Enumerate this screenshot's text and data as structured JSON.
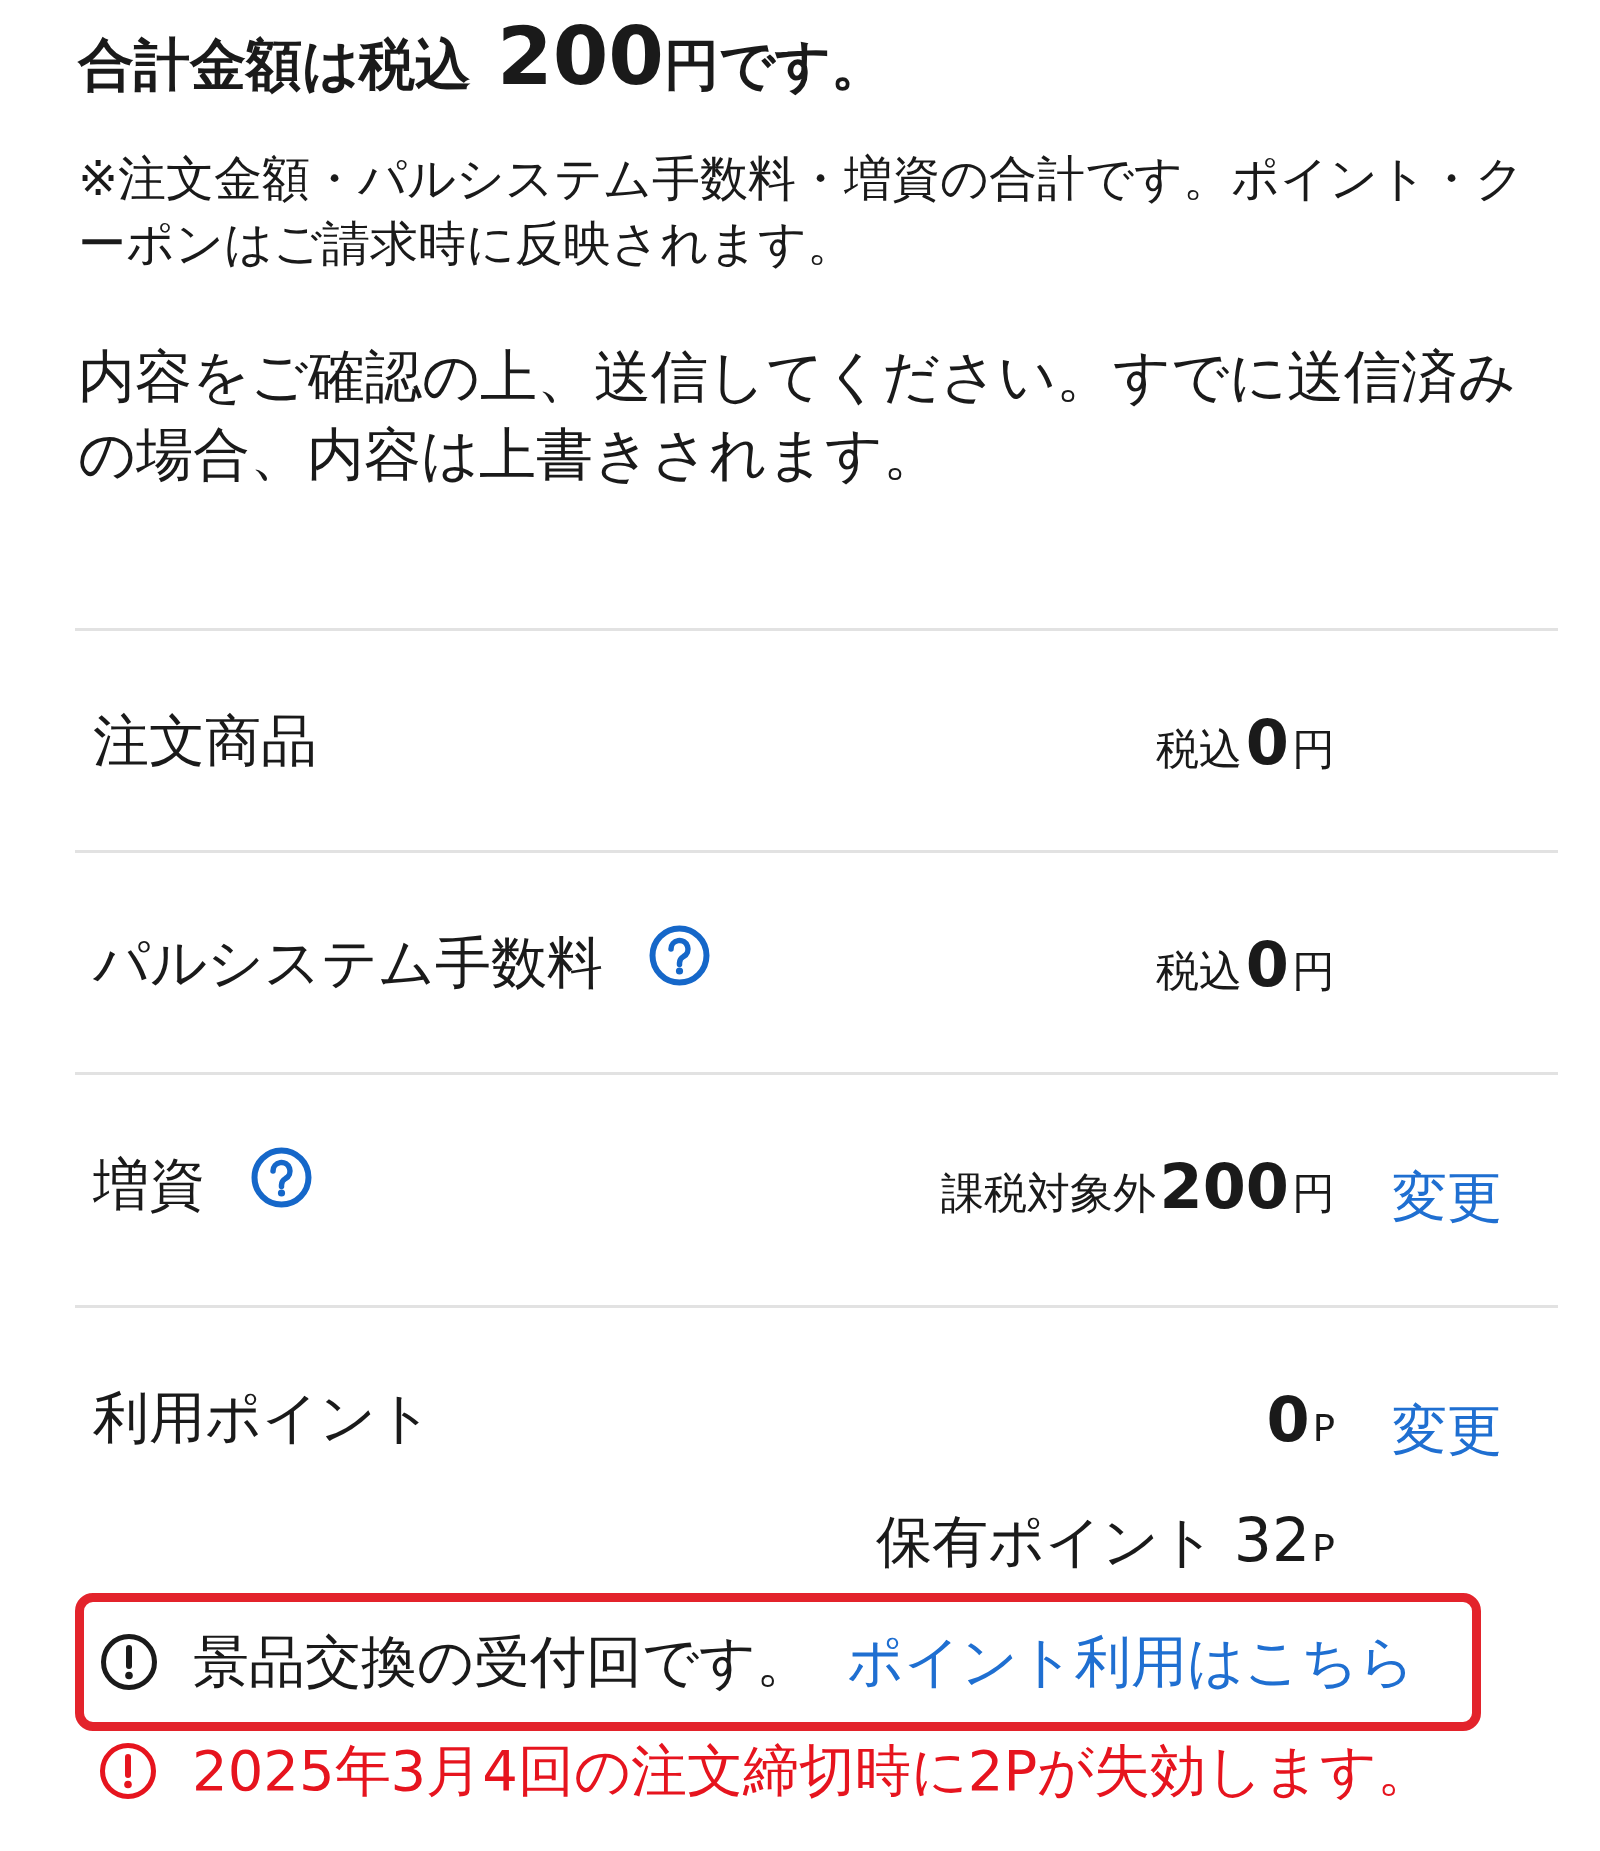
{
  "total": {
    "label": "合計金額は税込",
    "amount": "200",
    "unit": "円です。"
  },
  "note": "※注文金額・パルシステム手数料・増資の合計です。ポイント・クーポンはご請求時に反映されます。",
  "instruction": "内容をご確認の上、送信してください。すでに送信済みの場合、内容は上書きされます。",
  "rows": [
    {
      "label": "注文商品",
      "help": false,
      "prefix": "税込",
      "amount": "0",
      "unit": "円"
    },
    {
      "label": "パルシステム手数料",
      "help": true,
      "prefix": "税込",
      "amount": "0",
      "unit": "円"
    },
    {
      "label": "増資",
      "help": true,
      "prefix": "課税対象外",
      "amount": "200",
      "unit": "円",
      "action": "変更"
    },
    {
      "label": "利用ポイント",
      "help": false,
      "amount": "0",
      "unit": "P",
      "action": "変更",
      "held": {
        "label": "保有ポイント",
        "amount": "32",
        "unit": "P"
      }
    }
  ],
  "notice": {
    "text": "景品交換の受付回です。",
    "link": "ポイント利用はこちら"
  },
  "warning": "2025年3月4回の注文締切時に2Pが失効します。"
}
